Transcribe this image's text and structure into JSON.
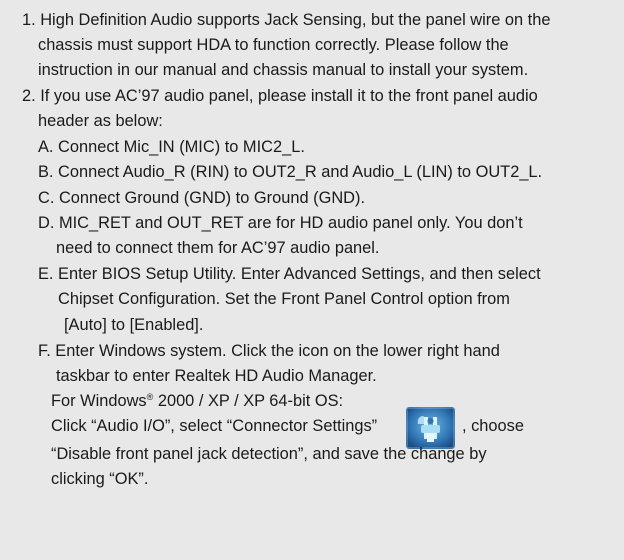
{
  "items": {
    "n1": [
      "1. High Definition Audio supports Jack Sensing, but the panel wire on the",
      "chassis must support HDA to function correctly. Please follow the",
      "instruction in our manual and chassis manual to install your system."
    ],
    "n2": [
      "2. If you use AC’97 audio panel, please install it to the front panel audio",
      "header as below:"
    ],
    "a": "A. Connect Mic_IN (MIC) to MIC2_L.",
    "b": "B. Connect Audio_R (RIN) to OUT2_R and Audio_L (LIN) to OUT2_L.",
    "c": "C. Connect Ground (GND) to Ground (GND).",
    "d": [
      "D. MIC_RET and OUT_RET are for HD audio panel only. You don’t",
      "need to connect them for AC’97 audio panel."
    ],
    "e": [
      "E. Enter BIOS Setup Utility. Enter Advanced Settings, and then select",
      "Chipset Configuration. Set the Front Panel Control option from",
      "[Auto] to [Enabled]."
    ],
    "f": [
      "F. Enter Windows system. Click the icon on the lower right hand",
      "taskbar to enter Realtek HD Audio Manager."
    ],
    "f_os_pre": "For Windows",
    "f_os_reg": "®",
    "f_os_post": " 2000 / XP / XP 64-bit OS:",
    "f_click": "Click “Audio I/O”, select “Connector Settings”",
    "f_choose": ", choose",
    "f_tail": [
      "“Disable front panel jack detection”, and save the change by",
      "clicking “OK”."
    ]
  },
  "icon": {
    "name": "connector-settings-icon",
    "bg": "#2f6fa8",
    "fg": "#8fd3f0"
  }
}
